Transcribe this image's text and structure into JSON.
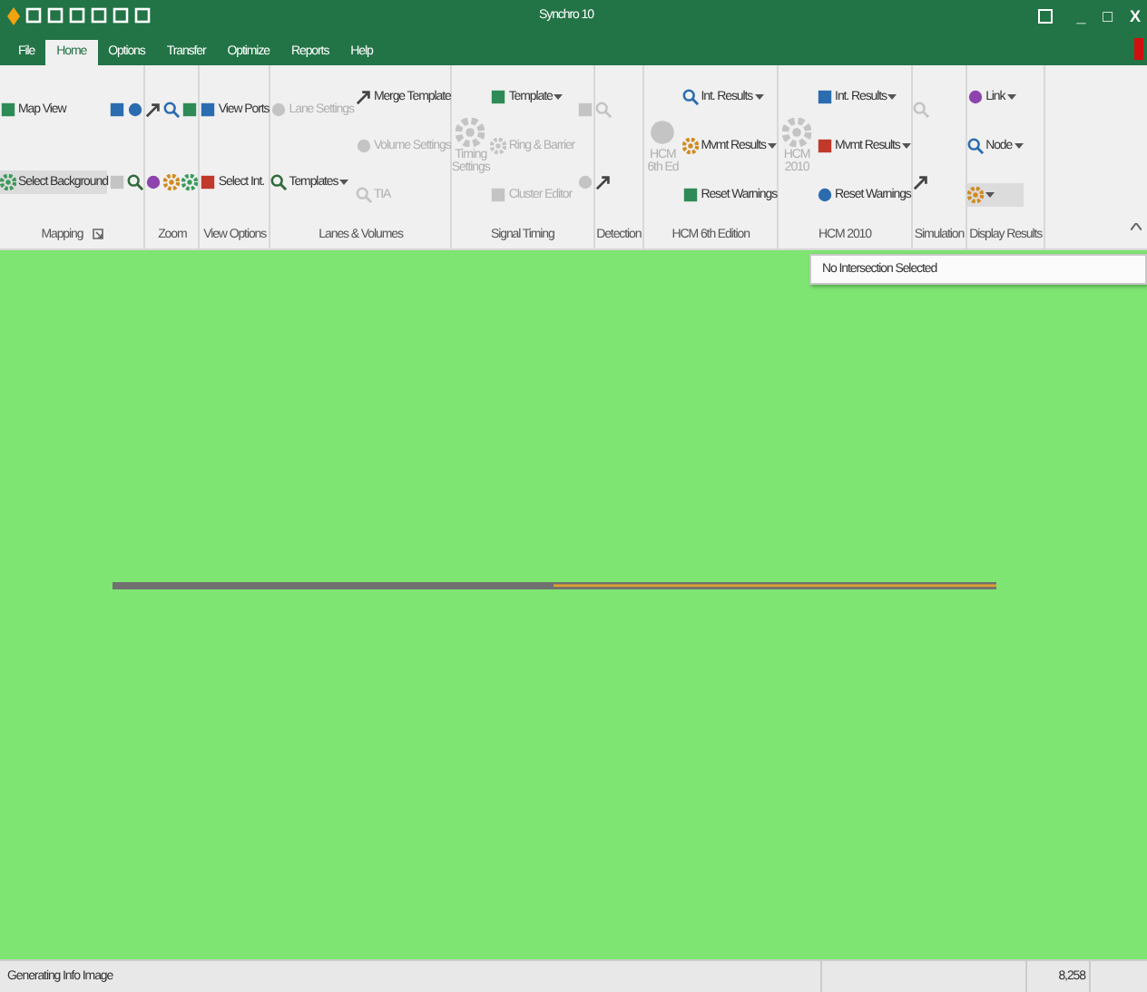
{
  "window": {
    "title": "Synchro 10",
    "controls": [
      "_",
      "□",
      "X"
    ]
  },
  "tabs": [
    {
      "label": "File",
      "selected": false
    },
    {
      "label": "Home",
      "selected": true
    },
    {
      "label": "Options",
      "selected": false
    },
    {
      "label": "Transfer",
      "selected": false
    },
    {
      "label": "Optimize",
      "selected": false
    },
    {
      "label": "Reports",
      "selected": false
    },
    {
      "label": "Help",
      "selected": false
    }
  ],
  "ribbon": {
    "groups": [
      {
        "label": "Mapping",
        "launcher": true,
        "columns": [
          [
            {
              "label": "Map View",
              "disabled": false
            },
            {
              "label": "Select Background",
              "disabled": false,
              "selected": true
            }
          ],
          [
            {
              "disabled": false
            },
            {
              "disabled": true
            }
          ],
          [
            {
              "disabled": false
            },
            {
              "disabled": false
            }
          ]
        ]
      },
      {
        "label": "Zoom",
        "launcher": false,
        "columns": [
          [
            {
              "disabled": false
            },
            {
              "disabled": false
            }
          ],
          [
            {
              "disabled": false
            },
            {
              "disabled": false
            }
          ],
          [
            {
              "disabled": false
            },
            {
              "disabled": false
            }
          ]
        ]
      },
      {
        "label": "View Options",
        "launcher": false,
        "columns": [
          [
            {
              "label": "View Ports",
              "disabled": false
            },
            {
              "label": "Select Int.",
              "disabled": false
            }
          ]
        ]
      },
      {
        "label": "Lanes & Volumes",
        "launcher": false,
        "columns": [
          [
            {
              "label": "Lane Settings",
              "disabled": true
            },
            {
              "label": "Templates",
              "disabled": false,
              "dropdown": true
            }
          ],
          [
            {
              "label": "Merge Template",
              "disabled": false
            },
            {
              "label": "Volume Settings",
              "disabled": true
            },
            {
              "label": "TIA",
              "disabled": true
            }
          ]
        ]
      },
      {
        "label": "Signal Timing",
        "launcher": false,
        "columns": [
          [
            {
              "kind": "large",
              "label": "Timing Settings",
              "disabled": true
            }
          ],
          [
            {
              "label": "Template",
              "disabled": false,
              "dropdown": true
            },
            {
              "label": "Ring & Barrier",
              "disabled": true
            },
            {
              "label": "Cluster Editor",
              "disabled": true
            }
          ],
          [
            {
              "disabled": true
            },
            {
              "disabled": true
            }
          ]
        ]
      },
      {
        "label": "Detection",
        "launcher": false,
        "columns": [
          [
            {
              "disabled": true
            },
            {
              "disabled": false
            }
          ]
        ]
      },
      {
        "label": "HCM 6th Edition",
        "launcher": false,
        "columns": [
          [
            {
              "kind": "large",
              "label": "HCM 6th Ed",
              "disabled": true
            }
          ],
          [
            {
              "label": "Int. Results",
              "disabled": false,
              "dropdown": true
            },
            {
              "label": "Mvmt Results",
              "disabled": false,
              "dropdown": true
            },
            {
              "label": "Reset Warnings",
              "disabled": false
            }
          ]
        ]
      },
      {
        "label": "HCM 2010",
        "launcher": false,
        "columns": [
          [
            {
              "kind": "large",
              "label": "HCM 2010",
              "disabled": true
            }
          ],
          [
            {
              "label": "Int. Results",
              "disabled": false,
              "dropdown": true
            },
            {
              "label": "Mvmt Results",
              "disabled": false,
              "dropdown": true
            },
            {
              "label": "Reset Warnings",
              "disabled": false
            }
          ]
        ]
      },
      {
        "label": "Simulation",
        "launcher": false,
        "columns": [
          [
            {
              "disabled": true
            },
            {
              "disabled": false
            }
          ]
        ]
      },
      {
        "label": "Display Results",
        "launcher": false,
        "columns": [
          [
            {
              "label": "Link",
              "disabled": false,
              "dropdown": true
            },
            {
              "label": "Node",
              "disabled": false,
              "dropdown": true
            },
            {
              "disabled": false,
              "dropdown": true,
              "selected": true
            }
          ]
        ]
      }
    ]
  },
  "info_dropdown": {
    "text": "No Intersection Selected"
  },
  "status_bar": {
    "message": "Generating Info Image",
    "panels": [
      "8,258"
    ]
  }
}
